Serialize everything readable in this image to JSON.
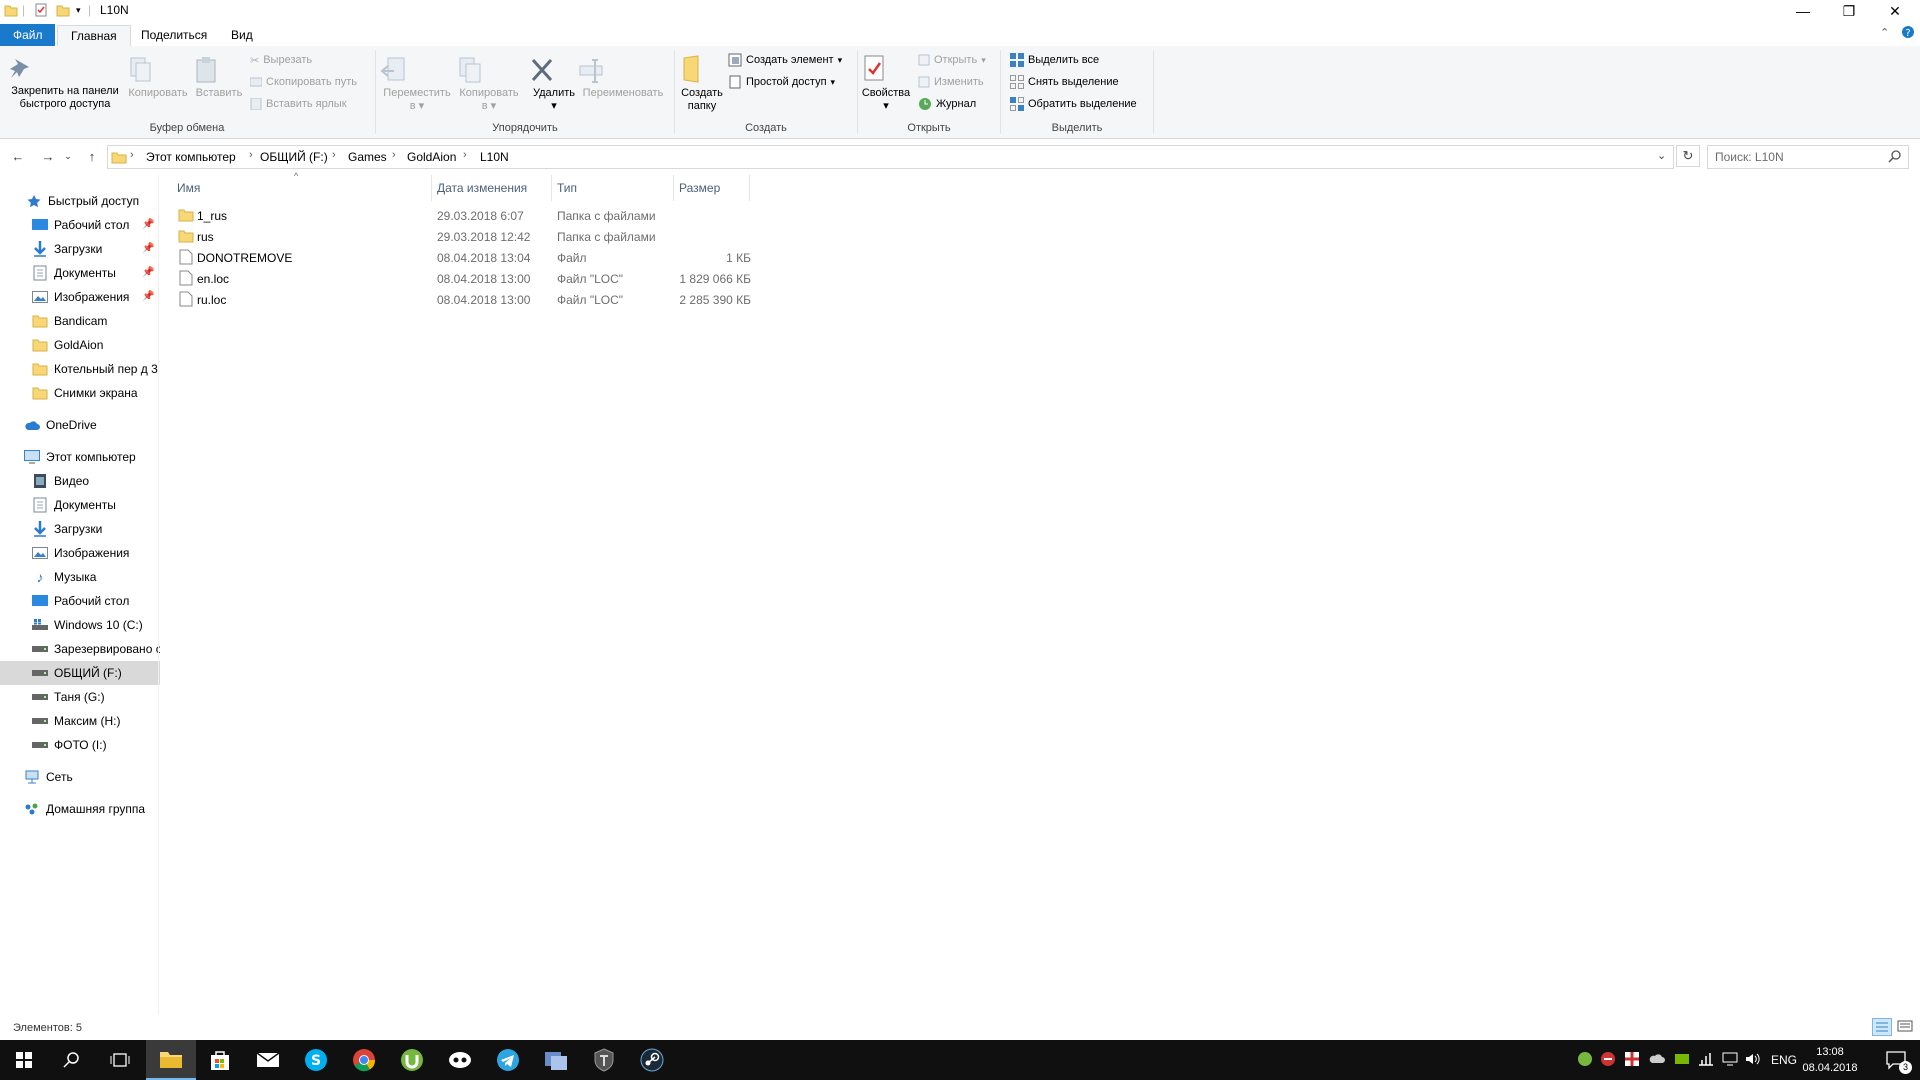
{
  "window": {
    "title": "L10N",
    "minimize": "—",
    "maximize": "❐",
    "close": "✕"
  },
  "tabs": {
    "file": "Файл",
    "home": "Главная",
    "share": "Поделиться",
    "view": "Вид"
  },
  "ribbon": {
    "clipboard": {
      "label": "Буфер обмена",
      "pin_line1": "Закрепить на панели",
      "pin_line2": "быстрого доступа",
      "copy": "Копировать",
      "paste": "Вставить",
      "cut": "Вырезать",
      "copy_path": "Скопировать путь",
      "paste_shortcut": "Вставить ярлык"
    },
    "organize": {
      "label": "Упорядочить",
      "move_line1": "Переместить",
      "move_line2": "в",
      "copyto_line1": "Копировать",
      "copyto_line2": "в",
      "delete": "Удалить",
      "rename": "Переименовать"
    },
    "create": {
      "label": "Создать",
      "new_folder_line1": "Создать",
      "new_folder_line2": "папку",
      "new_item": "Создать элемент",
      "easy_access": "Простой доступ"
    },
    "open": {
      "label": "Открыть",
      "properties": "Свойства",
      "open": "Открыть",
      "edit": "Изменить",
      "history": "Журнал"
    },
    "select": {
      "label": "Выделить",
      "select_all": "Выделить все",
      "select_none": "Снять выделение",
      "invert": "Обратить выделение"
    }
  },
  "address": {
    "crumbs": [
      "Этот компьютер",
      "ОБЩИЙ (F:)",
      "Games",
      "GoldAion",
      "L10N"
    ],
    "search_placeholder": "Поиск: L10N"
  },
  "nav": {
    "quick_access": "Быстрый доступ",
    "quick_items": [
      "Рабочий стол",
      "Загрузки",
      "Документы",
      "Изображения",
      "Bandicam",
      "GoldAion",
      "Котельный пер д 3",
      "Снимки экрана"
    ],
    "onedrive": "OneDrive",
    "this_pc": "Этот компьютер",
    "pc_items": [
      "Видео",
      "Документы",
      "Загрузки",
      "Изображения",
      "Музыка",
      "Рабочий стол",
      "Windows 10 (C:)",
      "Зарезервировано системой",
      "ОБЩИЙ (F:)",
      "Таня (G:)",
      "Максим (H:)",
      "ФОТО (I:)"
    ],
    "network": "Сеть",
    "homegroup": "Домашняя группа"
  },
  "columns": {
    "name": "Имя",
    "date": "Дата изменения",
    "type": "Тип",
    "size": "Размер"
  },
  "files": [
    {
      "name": "1_rus",
      "date": "29.03.2018 6:07",
      "type": "Папка с файлами",
      "size": "",
      "kind": "folder"
    },
    {
      "name": "rus",
      "date": "29.03.2018 12:42",
      "type": "Папка с файлами",
      "size": "",
      "kind": "folder"
    },
    {
      "name": "DONOTREMOVE",
      "date": "08.04.2018 13:04",
      "type": "Файл",
      "size": "1 КБ",
      "kind": "file"
    },
    {
      "name": "en.loc",
      "date": "08.04.2018 13:00",
      "type": "Файл \"LOC\"",
      "size": "1 829 066 КБ",
      "kind": "file"
    },
    {
      "name": "ru.loc",
      "date": "08.04.2018 13:00",
      "type": "Файл \"LOC\"",
      "size": "2 285 390 КБ",
      "kind": "file"
    }
  ],
  "status": {
    "count": "Элементов: 5"
  },
  "taskbar": {
    "lang": "ENG",
    "time": "13:08",
    "date": "08.04.2018",
    "notifications": "3"
  },
  "colors": {
    "accent": "#1979ca",
    "folder": "#f8d775",
    "selection": "#d9d9d9"
  }
}
